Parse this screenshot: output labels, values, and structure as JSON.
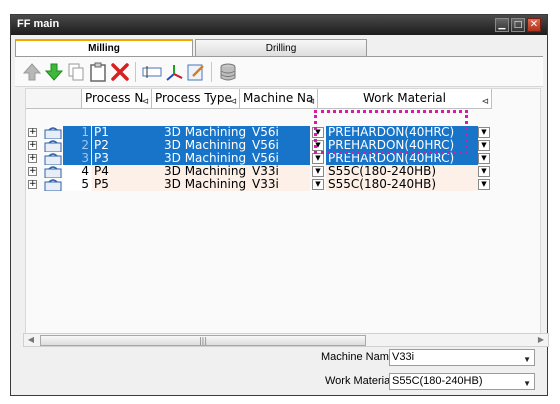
{
  "window": {
    "title": "FF main",
    "min_icon": "minimize-icon",
    "max_icon": "maximize-icon",
    "close_icon": "close-icon"
  },
  "tabs": [
    {
      "label": "Milling",
      "active": true
    },
    {
      "label": "Drilling",
      "active": false
    }
  ],
  "toolbar": {
    "buttons": [
      "move-up-icon",
      "move-down-icon",
      "copy-icon",
      "paste-icon",
      "delete-icon",
      "rename-icon",
      "coordinate-icon",
      "edit-icon",
      "database-icon"
    ]
  },
  "grid": {
    "columns": [
      "Process N",
      "Process Type",
      "Machine Na",
      "Work Material"
    ],
    "rows": [
      {
        "num": "1",
        "name": "P1",
        "type": "3D Machining",
        "machine": "V56i",
        "material": "PREHARDON(40HRC)",
        "selected": true
      },
      {
        "num": "2",
        "name": "P2",
        "type": "3D Machining",
        "machine": "V56i",
        "material": "PREHARDON(40HRC)",
        "selected": true
      },
      {
        "num": "3",
        "name": "P3",
        "type": "3D Machining",
        "machine": "V56i",
        "material": "PREHARDON(40HRC)",
        "selected": true
      },
      {
        "num": "4",
        "name": "P4",
        "type": "3D Machining",
        "machine": "V33i",
        "material": "S55C(180-240HB)",
        "selected": false
      },
      {
        "num": "5",
        "name": "P5",
        "type": "3D Machining",
        "machine": "V33i",
        "material": "S55C(180-240HB)",
        "selected": false
      }
    ]
  },
  "properties": {
    "machine_name": {
      "label": "Machine Name",
      "value": "V33i"
    },
    "work_material": {
      "label": "Work Material",
      "value": "S55C(180-240HB)"
    }
  },
  "colors": {
    "selection": "#1874c8",
    "highlight": "#d81aa8",
    "tab_accent": "#f0a800"
  }
}
